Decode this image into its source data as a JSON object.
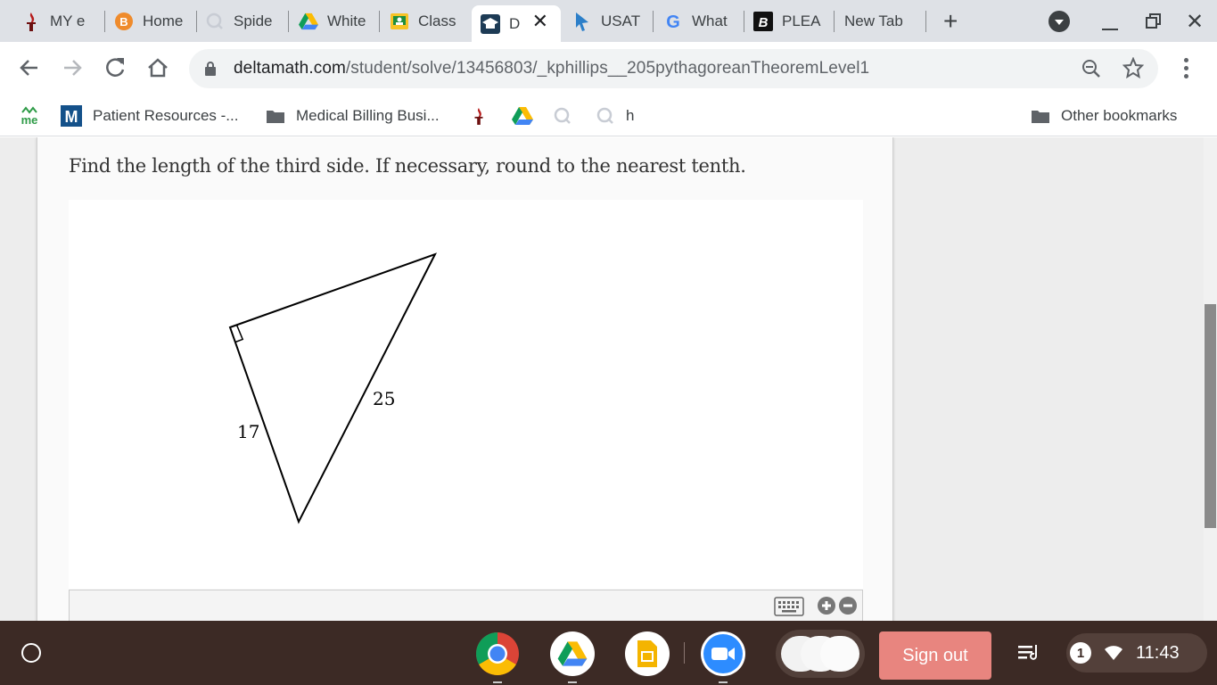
{
  "browser": {
    "tabs": [
      {
        "label": "MY e",
        "icon": "torch-icon"
      },
      {
        "label": "Home",
        "icon": "bitcoin-icon"
      },
      {
        "label": "Spide",
        "icon": "q-icon"
      },
      {
        "label": "White",
        "icon": "drive-icon"
      },
      {
        "label": "Class",
        "icon": "classroom-icon"
      },
      {
        "label": "D",
        "icon": "deltamath-icon"
      },
      {
        "label": "USAT",
        "icon": "cursor-icon"
      },
      {
        "label": "What",
        "icon": "google-icon"
      },
      {
        "label": "PLEA",
        "icon": "b-icon"
      },
      {
        "label": "New Tab",
        "icon": ""
      }
    ],
    "url_host": "deltamath.com",
    "url_path": "/student/solve/13456803/_kphillips__205pythagoreanTheoremLevel1",
    "bookmarks": [
      {
        "label": "",
        "icon": "me-icon"
      },
      {
        "label": "Patient Resources -...",
        "icon": "m-icon"
      },
      {
        "label": "Medical Billing Busi...",
        "icon": "folder-icon"
      },
      {
        "label": "",
        "icon": "torch-icon"
      },
      {
        "label": "",
        "icon": "drive-icon"
      },
      {
        "label": "",
        "icon": "q-icon"
      },
      {
        "label": "h",
        "icon": "q-icon"
      }
    ],
    "other_bookmarks": "Other bookmarks"
  },
  "problem": {
    "prompt": "Find the length of the third side. If necessary, round to the nearest tenth.",
    "side_a_label": "17",
    "hypotenuse_label": "25"
  },
  "shelf": {
    "sign_out": "Sign out",
    "notification_count": "1",
    "time": "11:43"
  },
  "colors": {
    "tabbar_bg": "#dee1e6",
    "shelf_bg": "#3c2a25",
    "sign_out_bg": "#e8857f"
  }
}
